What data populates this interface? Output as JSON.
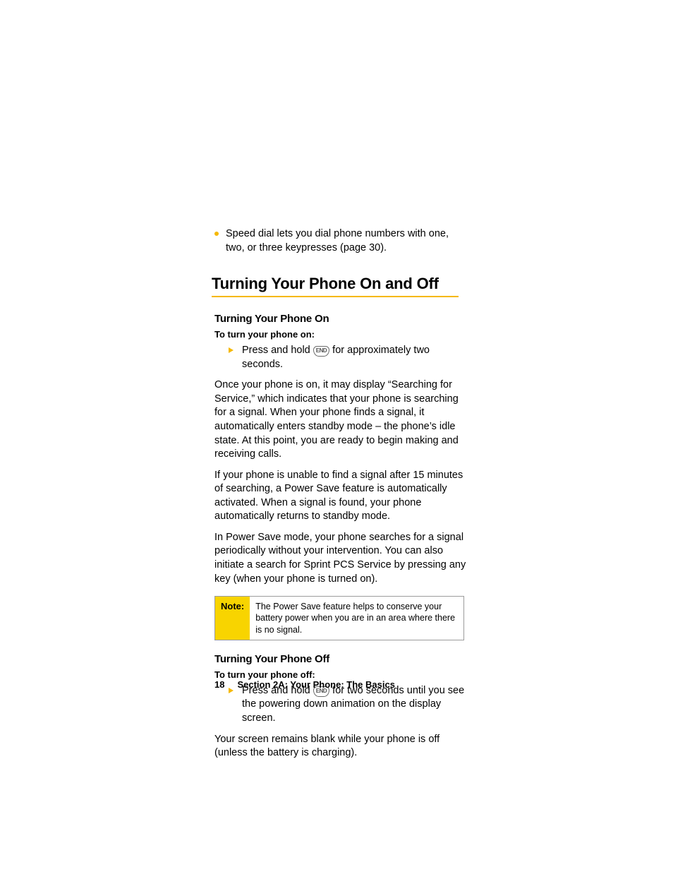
{
  "intro_bullet": "Speed dial lets you dial phone numbers with one, two, or three keypresses (page 30).",
  "heading": "Turning Your Phone On and Off",
  "on": {
    "subheading": "Turning Your Phone On",
    "instruction": "To turn your phone on:",
    "step_pre": "Press and hold ",
    "key": "END",
    "step_post": " for approximately two seconds.",
    "para1": "Once your phone is on, it may display “Searching for Service,” which indicates that your phone is searching for a signal. When your phone finds a signal, it automatically enters standby mode – the phone’s idle state. At this point, you are ready to begin making and receiving calls.",
    "para2": "If your phone is unable to find a signal after 15 minutes of searching, a Power Save feature is automatically activated. When a signal is found, your phone automatically returns to standby mode.",
    "para3": "In Power Save mode, your phone searches for a signal periodically without your intervention. You can also initiate a search for Sprint PCS Service by pressing any key (when your phone is turned on)."
  },
  "note": {
    "label": "Note:",
    "body": "The Power Save feature helps to conserve your battery power when you are in an area where there is no signal."
  },
  "off": {
    "subheading": "Turning Your Phone Off",
    "instruction": "To turn your phone off:",
    "step_pre": "Press and hold ",
    "key": "END",
    "step_post": " for two seconds until you see the powering down animation on the display screen.",
    "para1": "Your screen remains blank while your phone is off (unless the battery is charging)."
  },
  "footer": {
    "page_number": "18",
    "section": "Section 2A: Your Phone: The Basics"
  }
}
